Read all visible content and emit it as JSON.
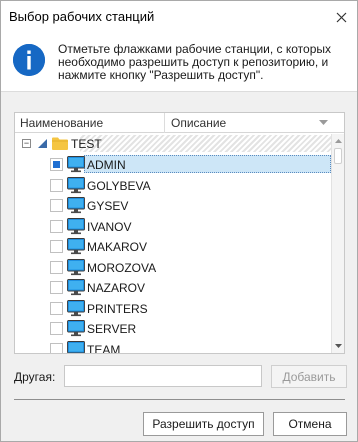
{
  "window": {
    "title": "Выбор рабочих станций"
  },
  "info": {
    "text": "Отметьте флажками рабочие станции, с которых необходимо разрешить доступ к репозиторию, и нажмите кнопку \"Разрешить доступ\"."
  },
  "grid": {
    "columns": [
      "Наименование",
      "Описание"
    ],
    "root": {
      "label": "TEST",
      "checked_state": "partial"
    },
    "items": [
      {
        "label": "ADMIN",
        "checked": true,
        "selected": true
      },
      {
        "label": "GOLYBEVA",
        "checked": false,
        "selected": false
      },
      {
        "label": "GYSEV",
        "checked": false,
        "selected": false
      },
      {
        "label": "IVANOV",
        "checked": false,
        "selected": false
      },
      {
        "label": "MAKAROV",
        "checked": false,
        "selected": false
      },
      {
        "label": "MOROZOVA",
        "checked": false,
        "selected": false
      },
      {
        "label": "NAZAROV",
        "checked": false,
        "selected": false
      },
      {
        "label": "PRINTERS",
        "checked": false,
        "selected": false
      },
      {
        "label": "SERVER",
        "checked": false,
        "selected": false
      },
      {
        "label": "TEAM",
        "checked": false,
        "selected": false
      }
    ]
  },
  "other": {
    "label": "Другая:",
    "value": "",
    "add_label": "Добавить"
  },
  "footer": {
    "allow_label": "Разрешить доступ",
    "cancel_label": "Отмена"
  },
  "icons": {
    "close": "close-icon",
    "info": "info-icon",
    "folder": "folder-icon",
    "workstation": "monitor-icon"
  },
  "colors": {
    "info_icon": "#1668c4",
    "selection": "#cde6f7",
    "checkbox_fill": "#1f6fd1",
    "folder": "#f5c542",
    "monitor": "#1e8fe0"
  }
}
